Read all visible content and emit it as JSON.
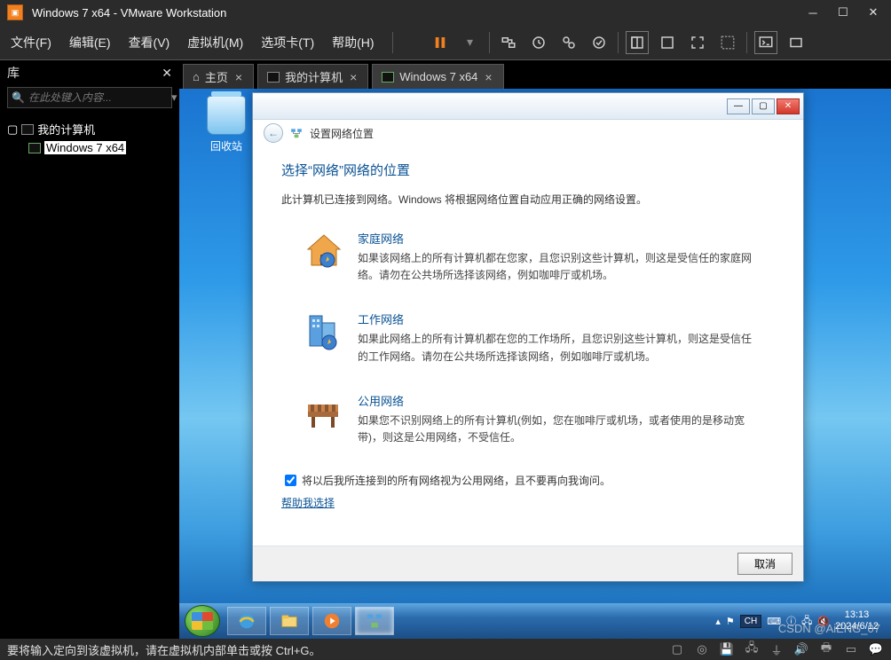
{
  "vmware": {
    "title": "Windows 7 x64 - VMware Workstation",
    "menu": {
      "file": "文件(F)",
      "edit": "编辑(E)",
      "view": "查看(V)",
      "vm": "虚拟机(M)",
      "tabs": "选项卡(T)",
      "help": "帮助(H)"
    },
    "library": {
      "title": "库",
      "search_placeholder": "在此处键入内容...",
      "root": "我的计算机",
      "vm": "Windows 7 x64"
    },
    "tabs": {
      "home": "主页",
      "mycomputer": "我的计算机",
      "win7": "Windows 7 x64"
    },
    "status": "要将输入定向到该虚拟机，请在虚拟机内部单击或按 Ctrl+G。"
  },
  "guest": {
    "recycle": "回收站",
    "taskbar": {
      "lang": "CH",
      "time": "13:13",
      "date": "2024/6/12",
      "speaker_muted": true
    }
  },
  "wizard": {
    "subtitle": "设置网络位置",
    "heading": "选择“网络”网络的位置",
    "intro": "此计算机已连接到网络。Windows 将根据网络位置自动应用正确的网络设置。",
    "home": {
      "title": "家庭网络",
      "desc": "如果该网络上的所有计算机都在您家，且您识别这些计算机，则这是受信任的家庭网络。请勿在公共场所选择该网络，例如咖啡厅或机场。"
    },
    "work": {
      "title": "工作网络",
      "desc": "如果此网络上的所有计算机都在您的工作场所，且您识别这些计算机，则这是受信任的工作网络。请勿在公共场所选择该网络，例如咖啡厅或机场。"
    },
    "public": {
      "title": "公用网络",
      "desc": "如果您不识别网络上的所有计算机(例如，您在咖啡厅或机场，或者使用的是移动宽带)，则这是公用网络，不受信任。"
    },
    "checkbox": "将以后我所连接到的所有网络视为公用网络，且不要再向我询问。",
    "help": "帮助我选择",
    "cancel": "取消"
  },
  "watermark": "CSDN @AiENG_07"
}
